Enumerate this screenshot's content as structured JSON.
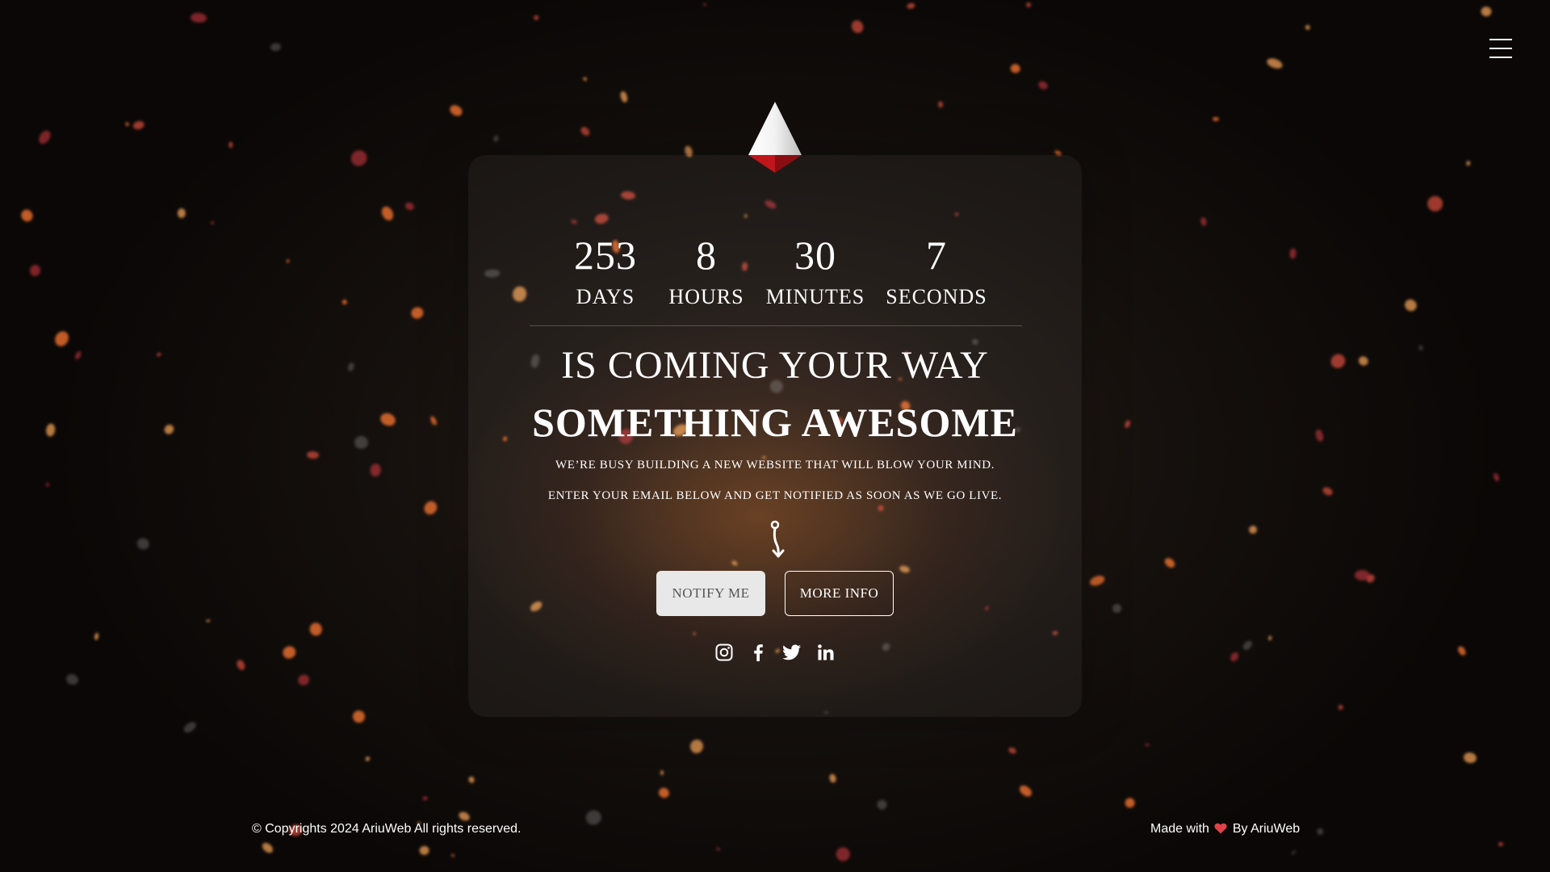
{
  "countdown": {
    "days": "253",
    "days_label": "DAYS",
    "hours": "8",
    "hours_label": "HOURS",
    "minutes": "30",
    "minutes_label": "MINUTES",
    "seconds": "7",
    "seconds_label": "SECONDS"
  },
  "hero": {
    "subhead": "IS COMING YOUR WAY",
    "headline": "SOMETHING AWESOME",
    "tagline_1": "WE’RE BUSY BUILDING A NEW WEBSITE THAT WILL BLOW YOUR MIND.",
    "tagline_2": "ENTER YOUR EMAIL BELOW AND GET NOTIFIED AS SOON AS WE GO LIVE."
  },
  "buttons": {
    "notify_label": "NOTIFY ME",
    "more_info_label": "MORE INFO"
  },
  "social": {
    "icons": [
      "instagram-icon",
      "facebook-icon",
      "twitter-icon",
      "linkedin-icon"
    ]
  },
  "footer": {
    "copyright": "© Copyrights 2024 AriuWeb All rights reserved.",
    "made_with": "Made with",
    "by": "By AriuWeb"
  },
  "colors": {
    "accent_red": "#c0151b",
    "heart": "#e0424a",
    "button_light": "#e8e8e8",
    "text": "#ffffff"
  }
}
